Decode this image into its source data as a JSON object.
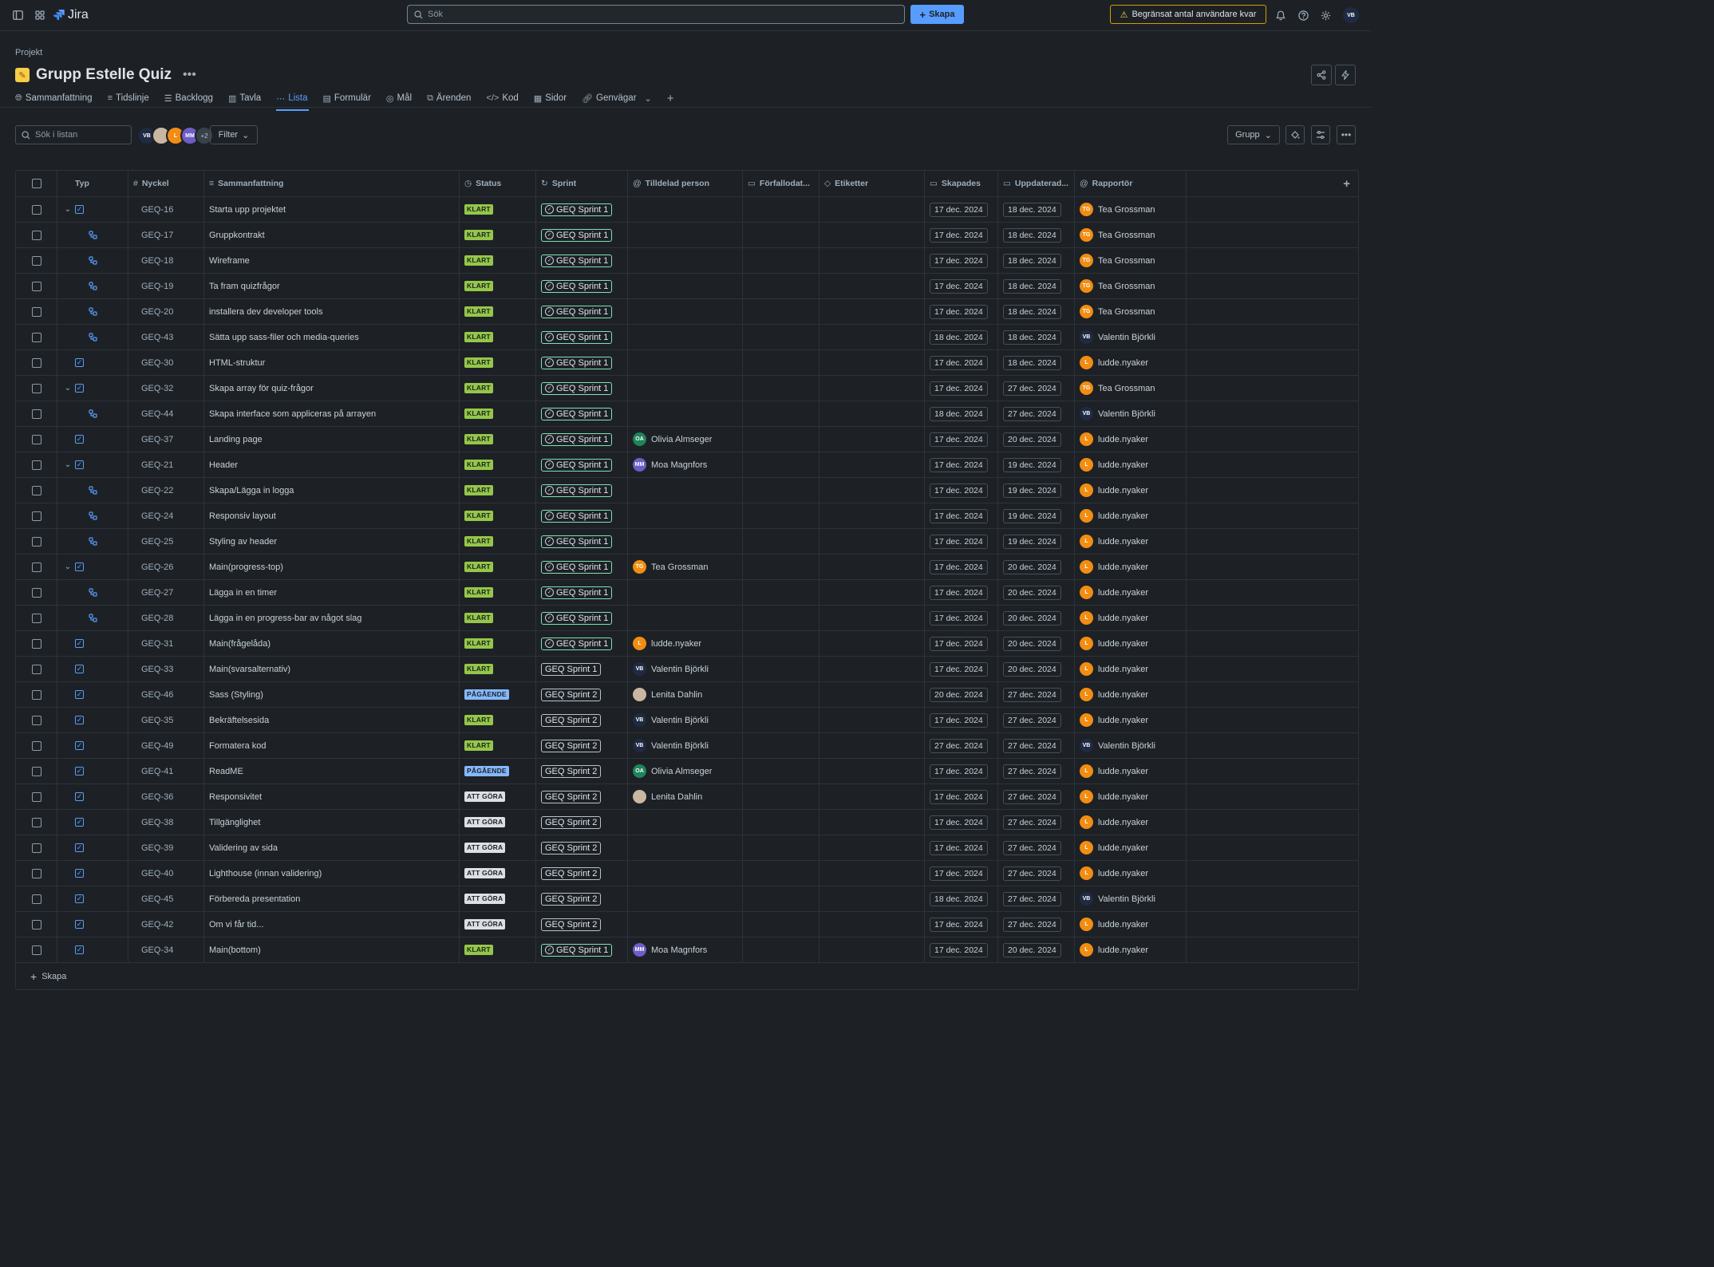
{
  "topbar": {
    "app_name": "Jira",
    "search_placeholder": "Sök",
    "create_label": "Skapa",
    "warning_label": "Begränsat antal användare kvar",
    "user_initials": "VB"
  },
  "header": {
    "breadcrumb": "Projekt",
    "title": "Grupp Estelle Quiz",
    "tabs": [
      {
        "label": "Sammanfattning",
        "icon": "globe-icon"
      },
      {
        "label": "Tidslinje",
        "icon": "timeline-icon"
      },
      {
        "label": "Backlogg",
        "icon": "backlog-icon"
      },
      {
        "label": "Tavla",
        "icon": "board-icon"
      },
      {
        "label": "Lista",
        "icon": "list-icon",
        "active": true
      },
      {
        "label": "Formulär",
        "icon": "form-icon"
      },
      {
        "label": "Mål",
        "icon": "target-icon"
      },
      {
        "label": "Ärenden",
        "icon": "issues-icon"
      },
      {
        "label": "Kod",
        "icon": "code-icon"
      },
      {
        "label": "Sidor",
        "icon": "pages-icon"
      },
      {
        "label": "Genvägar",
        "icon": "link-icon"
      }
    ]
  },
  "toolbar": {
    "search_placeholder": "Sök i listan",
    "avatars": [
      {
        "initials": "VB",
        "color": "#1f2a44"
      },
      {
        "initials": "",
        "color": "#c9b7a2"
      },
      {
        "initials": "L",
        "color": "#f18d13"
      },
      {
        "initials": "MM",
        "color": "#6e5dc6"
      }
    ],
    "more_count": "+2",
    "filter_label": "Filter",
    "group_label": "Grupp"
  },
  "columns": {
    "type": "Typ",
    "key": "Nyckel",
    "summary": "Sammanfattning",
    "status": "Status",
    "sprint": "Sprint",
    "assignee": "Tilldelad person",
    "due": "Förfallodat...",
    "labels": "Etiketter",
    "created": "Skapades",
    "updated": "Uppdaterad...",
    "reporter": "Rapportör"
  },
  "people": {
    "TG": {
      "name": "Tea Grossman",
      "initials": "TG",
      "color": "#f18d13"
    },
    "VB": {
      "name": "Valentin Björkli",
      "initials": "VB",
      "color": "#1f2a44"
    },
    "L": {
      "name": "ludde.nyaker",
      "initials": "L",
      "color": "#f18d13"
    },
    "OA": {
      "name": "Olivia Almseger",
      "initials": "OA",
      "color": "#1f845a"
    },
    "MM": {
      "name": "Moa Magnfors",
      "initials": "MM",
      "color": "#6e5dc6"
    },
    "LD": {
      "name": "Lenita Dahlin",
      "initials": "",
      "color": "#c9b7a2"
    }
  },
  "rows": [
    {
      "kind": "task",
      "expand": true,
      "key": "GEQ-16",
      "summary": "Starta upp projektet",
      "status": "KLART",
      "sprint": "GEQ Sprint 1",
      "sprint_done": true,
      "assignee": "",
      "created": "17 dec. 2024",
      "updated": "18 dec. 2024",
      "reporter": "TG"
    },
    {
      "kind": "sub",
      "key": "GEQ-17",
      "summary": "Gruppkontrakt",
      "status": "KLART",
      "sprint": "GEQ Sprint 1",
      "sprint_done": true,
      "assignee": "",
      "created": "17 dec. 2024",
      "updated": "18 dec. 2024",
      "reporter": "TG"
    },
    {
      "kind": "sub",
      "key": "GEQ-18",
      "summary": "Wireframe",
      "status": "KLART",
      "sprint": "GEQ Sprint 1",
      "sprint_done": true,
      "assignee": "",
      "created": "17 dec. 2024",
      "updated": "18 dec. 2024",
      "reporter": "TG"
    },
    {
      "kind": "sub",
      "key": "GEQ-19",
      "summary": "Ta fram quizfrågor",
      "status": "KLART",
      "sprint": "GEQ Sprint 1",
      "sprint_done": true,
      "assignee": "",
      "created": "17 dec. 2024",
      "updated": "18 dec. 2024",
      "reporter": "TG"
    },
    {
      "kind": "sub",
      "key": "GEQ-20",
      "summary": "installera dev developer tools",
      "status": "KLART",
      "sprint": "GEQ Sprint 1",
      "sprint_done": true,
      "assignee": "",
      "created": "17 dec. 2024",
      "updated": "18 dec. 2024",
      "reporter": "TG"
    },
    {
      "kind": "sub",
      "key": "GEQ-43",
      "summary": "Sätta upp sass-filer och media-queries",
      "status": "KLART",
      "sprint": "GEQ Sprint 1",
      "sprint_done": true,
      "assignee": "",
      "created": "18 dec. 2024",
      "updated": "18 dec. 2024",
      "reporter": "VB"
    },
    {
      "kind": "task",
      "key": "GEQ-30",
      "summary": "HTML-struktur",
      "status": "KLART",
      "sprint": "GEQ Sprint 1",
      "sprint_done": true,
      "assignee": "",
      "created": "17 dec. 2024",
      "updated": "18 dec. 2024",
      "reporter": "L"
    },
    {
      "kind": "task",
      "expand": true,
      "key": "GEQ-32",
      "summary": "Skapa array för quiz-frågor",
      "status": "KLART",
      "sprint": "GEQ Sprint 1",
      "sprint_done": true,
      "assignee": "",
      "created": "17 dec. 2024",
      "updated": "27 dec. 2024",
      "reporter": "TG"
    },
    {
      "kind": "sub",
      "key": "GEQ-44",
      "summary": "Skapa interface som appliceras på arrayen",
      "status": "KLART",
      "sprint": "GEQ Sprint 1",
      "sprint_done": true,
      "assignee": "",
      "created": "18 dec. 2024",
      "updated": "27 dec. 2024",
      "reporter": "VB"
    },
    {
      "kind": "task",
      "key": "GEQ-37",
      "summary": "Landing page",
      "status": "KLART",
      "sprint": "GEQ Sprint 1",
      "sprint_done": true,
      "assignee": "OA",
      "created": "17 dec. 2024",
      "updated": "20 dec. 2024",
      "reporter": "L"
    },
    {
      "kind": "task",
      "expand": true,
      "key": "GEQ-21",
      "summary": "Header",
      "status": "KLART",
      "sprint": "GEQ Sprint 1",
      "sprint_done": true,
      "assignee": "MM",
      "created": "17 dec. 2024",
      "updated": "19 dec. 2024",
      "reporter": "L"
    },
    {
      "kind": "sub",
      "key": "GEQ-22",
      "summary": "Skapa/Lägga in logga",
      "status": "KLART",
      "sprint": "GEQ Sprint 1",
      "sprint_done": true,
      "assignee": "",
      "created": "17 dec. 2024",
      "updated": "19 dec. 2024",
      "reporter": "L"
    },
    {
      "kind": "sub",
      "key": "GEQ-24",
      "summary": "Responsiv layout",
      "status": "KLART",
      "sprint": "GEQ Sprint 1",
      "sprint_done": true,
      "assignee": "",
      "created": "17 dec. 2024",
      "updated": "19 dec. 2024",
      "reporter": "L"
    },
    {
      "kind": "sub",
      "key": "GEQ-25",
      "summary": "Styling av header",
      "status": "KLART",
      "sprint": "GEQ Sprint 1",
      "sprint_done": true,
      "assignee": "",
      "created": "17 dec. 2024",
      "updated": "19 dec. 2024",
      "reporter": "L"
    },
    {
      "kind": "task",
      "expand": true,
      "key": "GEQ-26",
      "summary": "Main(progress-top)",
      "status": "KLART",
      "sprint": "GEQ Sprint 1",
      "sprint_done": true,
      "assignee": "TG",
      "created": "17 dec. 2024",
      "updated": "20 dec. 2024",
      "reporter": "L"
    },
    {
      "kind": "sub",
      "key": "GEQ-27",
      "summary": "Lägga in en timer",
      "status": "KLART",
      "sprint": "GEQ Sprint 1",
      "sprint_done": true,
      "assignee": "",
      "created": "17 dec. 2024",
      "updated": "20 dec. 2024",
      "reporter": "L"
    },
    {
      "kind": "sub",
      "key": "GEQ-28",
      "summary": "Lägga in en progress-bar av något slag",
      "status": "KLART",
      "sprint": "GEQ Sprint 1",
      "sprint_done": true,
      "assignee": "",
      "created": "17 dec. 2024",
      "updated": "20 dec. 2024",
      "reporter": "L"
    },
    {
      "kind": "task",
      "key": "GEQ-31",
      "summary": "Main(frågelåda)",
      "status": "KLART",
      "sprint": "GEQ Sprint 1",
      "sprint_done": true,
      "assignee": "L",
      "created": "17 dec. 2024",
      "updated": "20 dec. 2024",
      "reporter": "L"
    },
    {
      "kind": "task",
      "key": "GEQ-33",
      "summary": "Main(svarsalternativ)",
      "status": "KLART",
      "sprint": "GEQ Sprint 1",
      "sprint_done": false,
      "assignee": "VB",
      "created": "17 dec. 2024",
      "updated": "20 dec. 2024",
      "reporter": "L"
    },
    {
      "kind": "task",
      "key": "GEQ-46",
      "summary": "Sass (Styling)",
      "status": "PÅGÅENDE",
      "sprint": "GEQ Sprint 2",
      "sprint_done": false,
      "assignee": "LD",
      "created": "20 dec. 2024",
      "updated": "27 dec. 2024",
      "reporter": "L"
    },
    {
      "kind": "task",
      "key": "GEQ-35",
      "summary": "Bekräftelsesida",
      "status": "KLART",
      "sprint": "GEQ Sprint 2",
      "sprint_done": false,
      "assignee": "VB",
      "created": "17 dec. 2024",
      "updated": "27 dec. 2024",
      "reporter": "L"
    },
    {
      "kind": "task",
      "key": "GEQ-49",
      "summary": "Formatera kod",
      "status": "KLART",
      "sprint": "GEQ Sprint 2",
      "sprint_done": false,
      "assignee": "VB",
      "created": "27 dec. 2024",
      "updated": "27 dec. 2024",
      "reporter": "VB"
    },
    {
      "kind": "task",
      "key": "GEQ-41",
      "summary": "ReadME",
      "status": "PÅGÅENDE",
      "sprint": "GEQ Sprint 2",
      "sprint_done": false,
      "assignee": "OA",
      "created": "17 dec. 2024",
      "updated": "27 dec. 2024",
      "reporter": "L"
    },
    {
      "kind": "task",
      "key": "GEQ-36",
      "summary": "Responsivitet",
      "status": "ATT GÖRA",
      "sprint": "GEQ Sprint 2",
      "sprint_done": false,
      "assignee": "LD",
      "created": "17 dec. 2024",
      "updated": "27 dec. 2024",
      "reporter": "L"
    },
    {
      "kind": "task",
      "key": "GEQ-38",
      "summary": "Tillgänglighet",
      "status": "ATT GÖRA",
      "sprint": "GEQ Sprint 2",
      "sprint_done": false,
      "assignee": "",
      "created": "17 dec. 2024",
      "updated": "27 dec. 2024",
      "reporter": "L"
    },
    {
      "kind": "task",
      "key": "GEQ-39",
      "summary": "Validering av sida",
      "status": "ATT GÖRA",
      "sprint": "GEQ Sprint 2",
      "sprint_done": false,
      "assignee": "",
      "created": "17 dec. 2024",
      "updated": "27 dec. 2024",
      "reporter": "L"
    },
    {
      "kind": "task",
      "key": "GEQ-40",
      "summary": "Lighthouse (innan validering)",
      "status": "ATT GÖRA",
      "sprint": "GEQ Sprint 2",
      "sprint_done": false,
      "assignee": "",
      "created": "17 dec. 2024",
      "updated": "27 dec. 2024",
      "reporter": "L"
    },
    {
      "kind": "task",
      "key": "GEQ-45",
      "summary": "Förbereda presentation",
      "status": "ATT GÖRA",
      "sprint": "GEQ Sprint 2",
      "sprint_done": false,
      "assignee": "",
      "created": "18 dec. 2024",
      "updated": "27 dec. 2024",
      "reporter": "VB"
    },
    {
      "kind": "task",
      "key": "GEQ-42",
      "summary": "Om vi får tid...",
      "status": "ATT GÖRA",
      "sprint": "GEQ Sprint 2",
      "sprint_done": false,
      "assignee": "",
      "created": "17 dec. 2024",
      "updated": "27 dec. 2024",
      "reporter": "L"
    },
    {
      "kind": "task",
      "key": "GEQ-34",
      "summary": "Main(bottom)",
      "status": "KLART",
      "sprint": "GEQ Sprint 1",
      "sprint_done": true,
      "assignee": "MM",
      "created": "17 dec. 2024",
      "updated": "20 dec. 2024",
      "reporter": "L"
    }
  ],
  "footer": {
    "create_label": "Skapa"
  },
  "status_colors": {
    "KLART": "done",
    "PÅGÅENDE": "prog",
    "ATT GÖRA": "todo"
  }
}
